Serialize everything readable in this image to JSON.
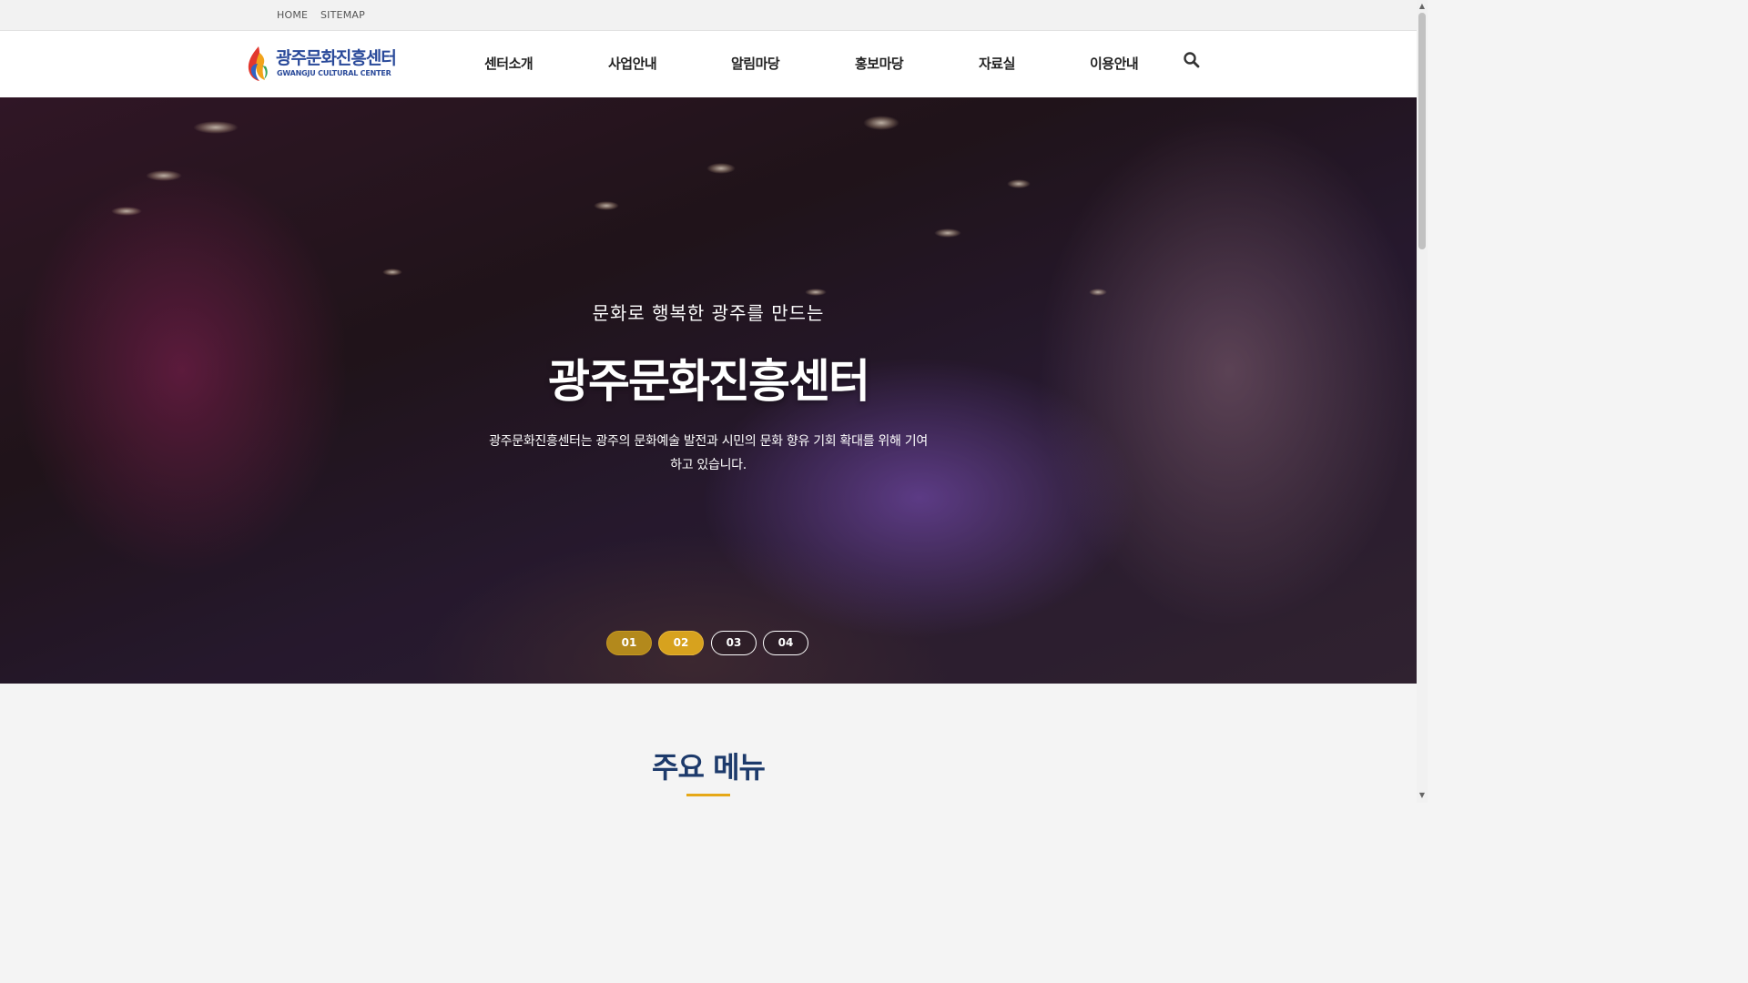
{
  "topbar": {
    "links": [
      "HOME",
      "SITEMAP"
    ]
  },
  "header": {
    "logo": {
      "title": "광주문화진흥센터",
      "subtitle": "GWANGJU CULTURAL CENTER"
    },
    "nav": [
      "센터소개",
      "사업안내",
      "알림마당",
      "홍보마당",
      "자료실",
      "이용안내"
    ],
    "search_icon": "search-icon"
  },
  "hero": {
    "subtitle": "문화로 행복한 광주를 만드는",
    "title": "광주문화진흥센터",
    "description_line1": "광주문화진흥센터는 광주의 문화예술 발전과 시민의 문화 향유 기회 확대를 위해 기여",
    "description_line2": "하고 있습니다.",
    "slides": [
      "01",
      "02",
      "03",
      "04"
    ],
    "active_slide": "02"
  },
  "main_menu": {
    "title": "주요 메뉴"
  },
  "colors": {
    "accent": "#d7a21e",
    "brand": "#2a4a9a",
    "section_title": "#1d3a6b"
  }
}
